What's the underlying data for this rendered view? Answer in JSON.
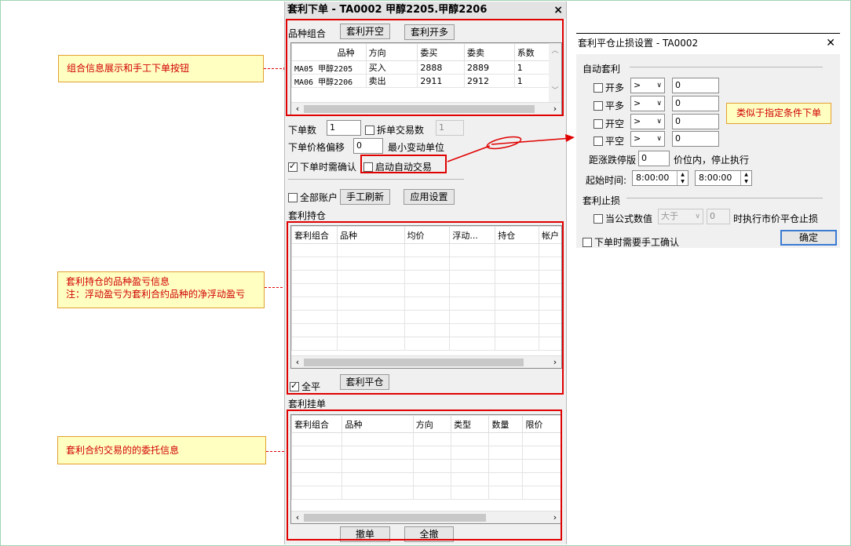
{
  "panel": {
    "title": "套利下单  -  TA0002 甲醇2205.甲醇2206",
    "close": "×"
  },
  "combo": {
    "label": "品种组合",
    "open_short_label": "套利开空",
    "open_long_label": "套利开多",
    "columns": [
      "品种",
      "方向",
      "委买",
      "委卖",
      "系数"
    ],
    "rows": [
      {
        "id": "MA05",
        "name": "甲醇2205",
        "dir": "买入",
        "bid": "2888",
        "ask": "2889",
        "coef": "1"
      },
      {
        "id": "MA06",
        "name": "甲醇2206",
        "dir": "卖出",
        "bid": "2911",
        "ask": "2912",
        "coef": "1"
      }
    ]
  },
  "order": {
    "qty_label": "下单数",
    "qty_value": "1",
    "split_label": "拆单交易数",
    "split_value": "1",
    "offset_label": "下单价格偏移",
    "offset_value": "0",
    "tick_label": "最小变动单位",
    "confirm_label": "下单时需确认",
    "auto_label": "启动自动交易",
    "all_accounts_label": "全部账户",
    "refresh_label": "手工刷新",
    "apply_label": "应用设置"
  },
  "positions": {
    "label": "套利持仓",
    "columns": [
      "套利组合",
      "品种",
      "均价",
      "浮动...",
      "持仓",
      "帐户"
    ],
    "close_all_label": "全平",
    "close_button_label": "套利平仓"
  },
  "pending": {
    "label": "套利挂单",
    "columns": [
      "套利组合",
      "品种",
      "方向",
      "类型",
      "数量",
      "限价"
    ],
    "cancel_label": "撤单",
    "cancel_all_label": "全撤"
  },
  "annotations": {
    "combo": "组合信息展示和手工下单按钮",
    "positions_1": "套利持仓的品种盈亏信息",
    "positions_2": "注：浮动盈亏为套利合约品种的净浮动盈亏",
    "pending": "套利合约交易的的委托信息",
    "dialog": "类似于指定条件下单"
  },
  "dialog": {
    "title": "套利平仓止损设置 - TA0002",
    "close": "✕",
    "auto_section": "自动套利",
    "rules": [
      {
        "label": "开多",
        "op": ">",
        "value": "0"
      },
      {
        "label": "平多",
        "op": ">",
        "value": "0"
      },
      {
        "label": "开空",
        "op": ">",
        "value": "0"
      },
      {
        "label": "平空",
        "op": ">",
        "value": "0"
      }
    ],
    "limit_prefix": "距涨跌停版",
    "limit_value": "0",
    "limit_suffix": "价位内，停止执行",
    "time_label": "起始时间:",
    "time_start": "8:00:00",
    "time_end": "8:00:00",
    "stop_section": "套利止损",
    "formula_label": "当公式数值",
    "formula_op": "大于",
    "formula_value": "0",
    "formula_suffix": "时执行市价平仓止损",
    "manual_confirm_label": "下单时需要手工确认",
    "ok_label": "确定"
  },
  "colors": {
    "annotation_red": "#e00000",
    "annotation_fill": "#ffffc2",
    "default_button_border": "#3b7bd4"
  }
}
